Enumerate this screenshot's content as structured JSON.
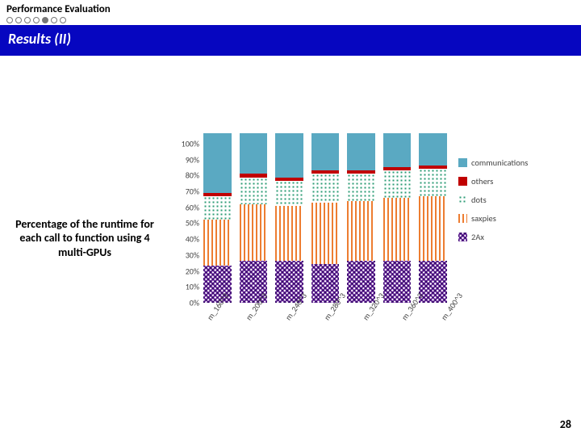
{
  "header": {
    "section": "Performance Evaluation",
    "progress_dots": 7,
    "progress_current": 5
  },
  "title": "Results (II)",
  "caption": "Percentage of the runtime for each call to function using 4 multi-GPUs",
  "page_number": "28",
  "chart_data": {
    "type": "bar",
    "stacked": true,
    "ylabel": "",
    "xlabel": "",
    "ylim": [
      0,
      100
    ],
    "yticks": [
      "0%",
      "10%",
      "20%",
      "30%",
      "40%",
      "50%",
      "60%",
      "70%",
      "80%",
      "90%",
      "100%"
    ],
    "categories": [
      "m_160^3",
      "m_200^3",
      "m_240^3",
      "m_280^3",
      "m_320^3",
      "m_360^3",
      "m_400^3"
    ],
    "series": [
      {
        "name": "2Ax",
        "key": "2ax",
        "values": [
          22,
          25,
          25,
          23,
          25,
          25,
          25
        ]
      },
      {
        "name": "saxpies",
        "key": "sax",
        "values": [
          27,
          33,
          32,
          36,
          35,
          37,
          38
        ]
      },
      {
        "name": "dots",
        "key": "dots",
        "values": [
          14,
          16,
          15,
          17,
          16,
          16,
          16
        ]
      },
      {
        "name": "others",
        "key": "oth",
        "values": [
          2,
          2,
          2,
          2,
          2,
          2,
          2
        ]
      },
      {
        "name": "communications",
        "key": "com",
        "values": [
          35,
          24,
          26,
          22,
          22,
          20,
          19
        ]
      }
    ],
    "legend_order": [
      "com",
      "oth",
      "dots",
      "sax",
      "2ax"
    ]
  }
}
